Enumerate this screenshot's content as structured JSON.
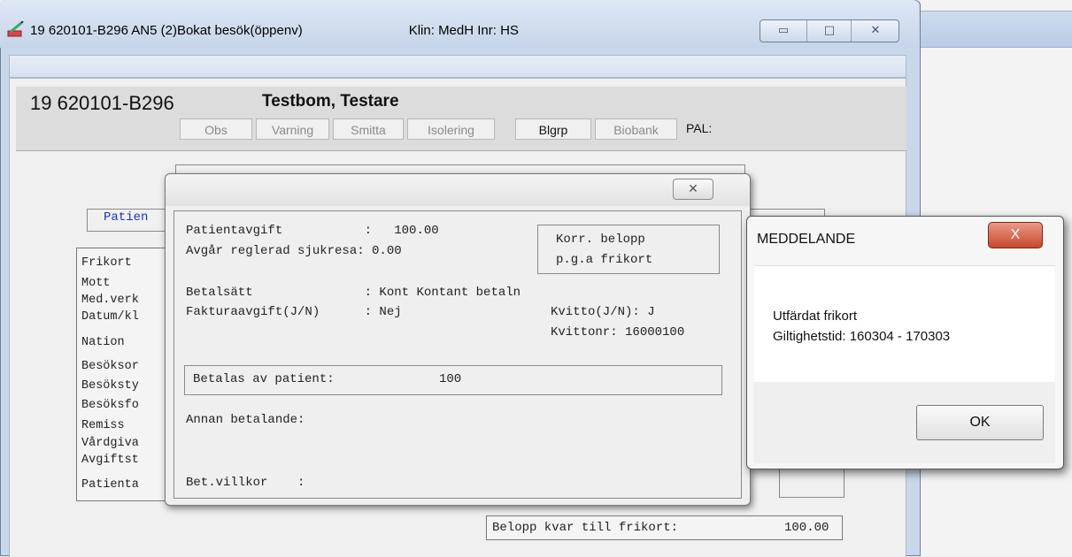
{
  "window": {
    "title": "19 620101-B296   AN5 (2)Bokat besök(öppenv)",
    "clinic": "Klin: MedH  Inr: HS",
    "buttons": {
      "minimize": "▭",
      "maximize": "□",
      "close": "✕"
    }
  },
  "patient": {
    "id": "19 620101-B296",
    "name": "Testbom, Testare"
  },
  "flags": [
    {
      "label": "Obs",
      "active": false
    },
    {
      "label": "Varning",
      "active": false
    },
    {
      "label": "Smitta",
      "active": false
    },
    {
      "label": "Isolering",
      "active": false
    },
    {
      "label": "Blgrp",
      "active": true
    },
    {
      "label": "Biobank",
      "active": false
    }
  ],
  "pal_label": "PAL:",
  "background_form": {
    "section_label": "Patien",
    "left_labels": [
      "Frikort",
      "Mott",
      "Med.verk",
      "Datum/kl",
      "Nation",
      "Besöksor",
      "Besöksty",
      "Besöksfo",
      "Remiss",
      "Vårdgiva",
      "Avgiftst",
      "Patienta"
    ],
    "remaining_label": "Belopp kvar till frikort:",
    "remaining_value": "100.00"
  },
  "payment_dialog": {
    "close": "✕",
    "patientavgift": "Patientavgift           :   100.00",
    "sjukresa": "Avgår reglerad sjukresa: 0.00",
    "korr_line1": "Korr. belopp",
    "korr_line2": "p.g.a frikort",
    "betalsatt": "Betalsätt               : Kont Kontant betaln",
    "fakturaavgift": "Fakturaavgift(J/N)      : Nej",
    "kvitto": "Kvitto(J/N): J",
    "kvittonr": "Kvittonr: 16000100",
    "betalas_label": "Betalas av patient:",
    "betalas_value": "100",
    "annan_betalande": "Annan betalande:",
    "bet_villkor": "Bet.villkor    :"
  },
  "message_dialog": {
    "title": "MEDDELANDE",
    "close": "X",
    "line1": "Utfärdat frikort",
    "line2": "Giltighetstid: 160304 - 170303",
    "ok": "OK"
  },
  "colors": {
    "accent_blue": "#1a33c8",
    "close_red": "#c8482c"
  }
}
